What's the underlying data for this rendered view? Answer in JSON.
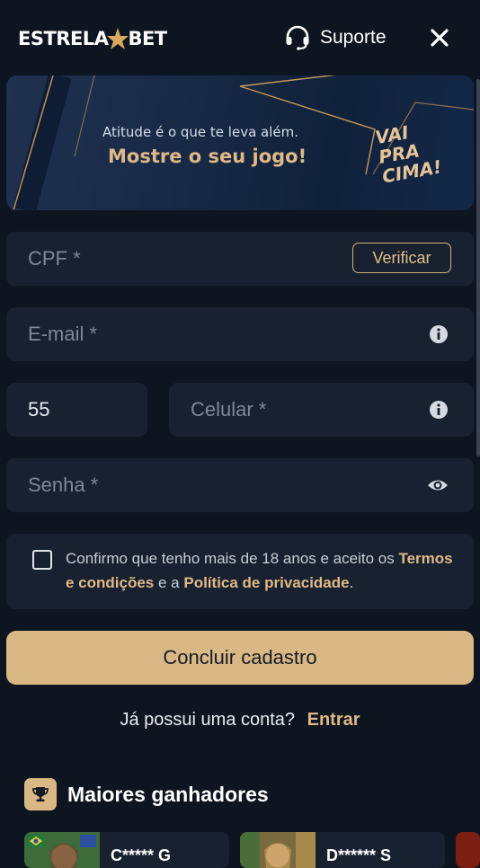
{
  "header": {
    "logo_left": "ESTRELA",
    "logo_right": "BET",
    "support_label": "Suporte"
  },
  "banner": {
    "tagline": "Atitude é o que te leva além.",
    "headline": "Mostre o seu jogo!",
    "slogan_line1": "VAI PRA",
    "slogan_line2": "CIMA!"
  },
  "form": {
    "cpf_placeholder": "CPF *",
    "verify_label": "Verificar",
    "email_placeholder": "E-mail *",
    "country_code": "55",
    "phone_placeholder": "Celular *",
    "password_placeholder": "Senha *",
    "terms_prefix": "Confirmo que tenho mais de 18 anos e aceito os",
    "terms_link": "Termos e condições",
    "terms_mid": " e a ",
    "privacy_link": "Política de privacidade",
    "terms_suffix": ".",
    "submit_label": "Concluir cadastro"
  },
  "login": {
    "question": "Já possui uma conta?",
    "link": "Entrar"
  },
  "winners": {
    "title": "Maiores ganhadores",
    "items": [
      {
        "name": "C***** G"
      },
      {
        "name": "D****** S"
      }
    ]
  },
  "colors": {
    "background": "#0d1520",
    "field": "#17212f",
    "accent": "#dab886"
  }
}
